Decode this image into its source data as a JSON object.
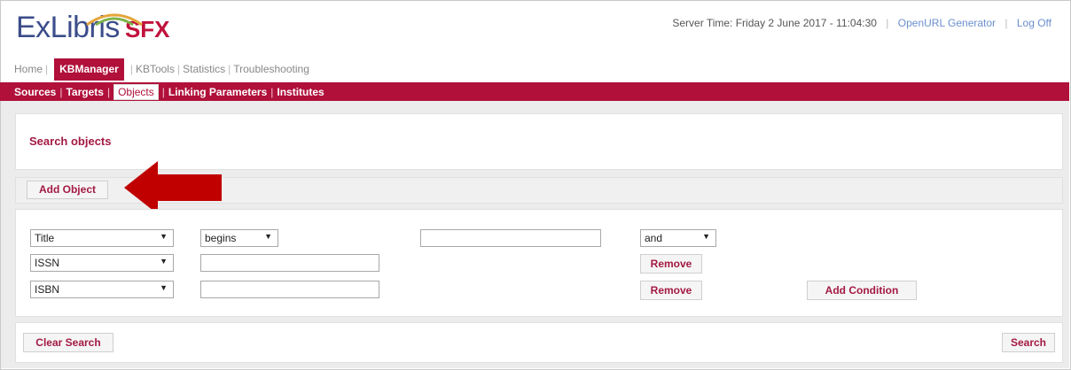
{
  "logo": {
    "main": "ExLibris",
    "product": "SFX"
  },
  "header": {
    "server_time": "Server Time: Friday 2 June 2017 - 11:04:30",
    "openurl_link": "OpenURL Generator",
    "logoff_link": "Log Off"
  },
  "main_nav": {
    "items": [
      "Home",
      "KBManager",
      "KBTools",
      "Statistics",
      "Troubleshooting"
    ],
    "active": "KBManager"
  },
  "sub_nav": {
    "items": [
      "Sources",
      "Targets",
      "Objects",
      "Linking Parameters",
      "Institutes"
    ],
    "active": "Objects"
  },
  "page_title": "Search objects",
  "add_object_label": "Add Object",
  "search_rows": [
    {
      "field": "Title",
      "operator": "begins",
      "value": "",
      "connector": "and"
    },
    {
      "field": "ISSN",
      "value": "",
      "action": "Remove"
    },
    {
      "field": "ISBN",
      "value": "",
      "action": "Remove"
    }
  ],
  "add_condition_label": "Add Condition",
  "clear_search_label": "Clear Search",
  "search_label": "Search",
  "colors": {
    "brand": "#b0103a",
    "link": "#6b8fd0",
    "arrow": "#c00000"
  }
}
